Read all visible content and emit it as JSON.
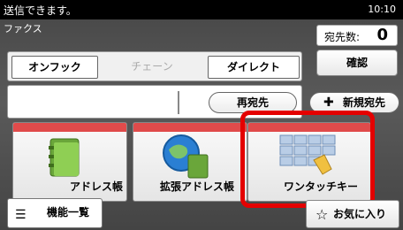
{
  "status_bar": {
    "message": "送信できます。",
    "time": "10:10"
  },
  "screen": {
    "title": "ファクス"
  },
  "destination": {
    "count_label": "宛先数:",
    "count_value": "0"
  },
  "confirm_label": "確認",
  "tabs": [
    {
      "label": "オンフック",
      "active": true
    },
    {
      "label": "チェーン",
      "active": false
    },
    {
      "label": "ダイレクト",
      "active": true
    }
  ],
  "resend_label": "再宛先",
  "new_dest_label": "新規宛先",
  "tiles": [
    {
      "label": "アドレス帳",
      "icon": "address-book-icon"
    },
    {
      "label": "拡張アドレス帳",
      "icon": "globe-icon"
    },
    {
      "label": "ワンタッチキー",
      "icon": "one-touch-key-icon"
    }
  ],
  "bottom": {
    "menu_label": "機能一覧",
    "favorites_label": "お気に入り"
  },
  "colors": {
    "accent_red": "#e04b4b",
    "highlight": "#e40000"
  }
}
